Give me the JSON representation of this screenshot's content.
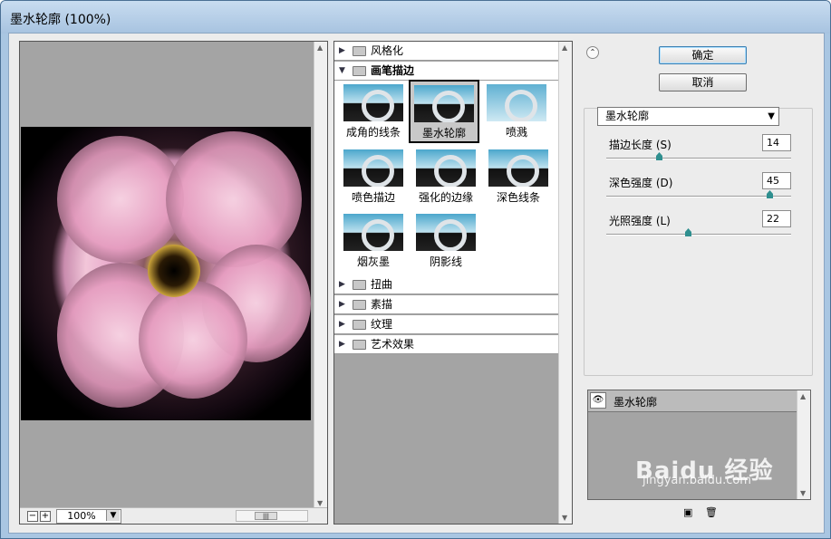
{
  "window": {
    "title": "墨水轮廓 (100%)"
  },
  "preview": {
    "zoom": "100%",
    "zoom_out": "−",
    "zoom_in": "+"
  },
  "filters": {
    "categories_top": [
      {
        "label": "风格化",
        "expanded": false
      },
      {
        "label": "画笔描边",
        "expanded": true
      }
    ],
    "thumbnails": [
      {
        "label": "成角的线条",
        "selected": false
      },
      {
        "label": "墨水轮廓",
        "selected": true
      },
      {
        "label": "喷溅",
        "selected": false
      },
      {
        "label": "喷色描边",
        "selected": false
      },
      {
        "label": "强化的边缘",
        "selected": false
      },
      {
        "label": "深色线条",
        "selected": false
      },
      {
        "label": "烟灰墨",
        "selected": false
      },
      {
        "label": "阴影线",
        "selected": false
      }
    ],
    "categories_bottom": [
      {
        "label": "扭曲"
      },
      {
        "label": "素描"
      },
      {
        "label": "纹理"
      },
      {
        "label": "艺术效果"
      }
    ]
  },
  "buttons": {
    "ok": "确定",
    "cancel": "取消"
  },
  "settings": {
    "filter_select": "墨水轮廓",
    "params": [
      {
        "label": "描边长度 (S)",
        "value": "14",
        "level": 0.28
      },
      {
        "label": "深色强度 (D)",
        "value": "45",
        "level": 0.9
      },
      {
        "label": "光照强度 (L)",
        "value": "22",
        "level": 0.44
      }
    ]
  },
  "layers": {
    "items": [
      {
        "name": "墨水轮廓"
      }
    ]
  },
  "watermark": {
    "brand": "Baidu 经验",
    "url": "jingyan.baidu.com"
  }
}
